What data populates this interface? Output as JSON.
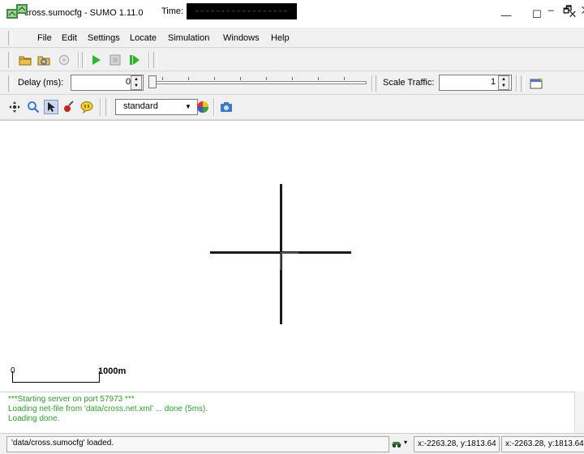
{
  "window": {
    "title": "cross.sumocfg - SUMO 1.11.0",
    "minimize_glyph": "—",
    "maximize_glyph": "☐",
    "close_glyph": "✕"
  },
  "menu": {
    "items": [
      {
        "label": "File"
      },
      {
        "label": "Edit"
      },
      {
        "label": "Settings"
      },
      {
        "label": "Locate"
      },
      {
        "label": "Simulation"
      },
      {
        "label": "Windows"
      },
      {
        "label": "Help"
      }
    ],
    "mdi_controls": "– 🗗 ✕"
  },
  "toolbar": {
    "time_label": "Time:",
    "time_value": "------------------",
    "delay_label": "Delay (ms):",
    "delay_value": "0",
    "scale_label": "Scale Traffic:",
    "scale_value": "1",
    "scheme_value": "standard"
  },
  "icons": {
    "open": "open-folder-icon",
    "reload": "reload-icon",
    "close": "close-sim-icon",
    "run": "play-icon",
    "stop": "stop-icon",
    "step": "step-icon",
    "recenter": "recenter-icon",
    "locate": "magnifier-icon",
    "select": "select-cursor-icon",
    "edit_breakpoints": "breakpoint-icon",
    "tooltips": "tooltip-icon",
    "color_editor": "color-wheel-icon",
    "snapshot": "camera-icon"
  },
  "canvas": {
    "scale_zero": "0",
    "scale_distance": "1000m"
  },
  "messages": [
    "***Starting server on port 57973 ***",
    "Loading net-file from 'data/cross.net.xml' ... done (5ms).",
    "Loading done."
  ],
  "status": {
    "text": "'data/cross.sumocfg' loaded.",
    "coord1": "x:-2263.28, y:1813.64",
    "coord2": "x:-2263.28, y:1813.64"
  },
  "colors": {
    "message_green": "#2a9e2a",
    "time_green": "#18c818",
    "play_green": "#2cb42c"
  }
}
